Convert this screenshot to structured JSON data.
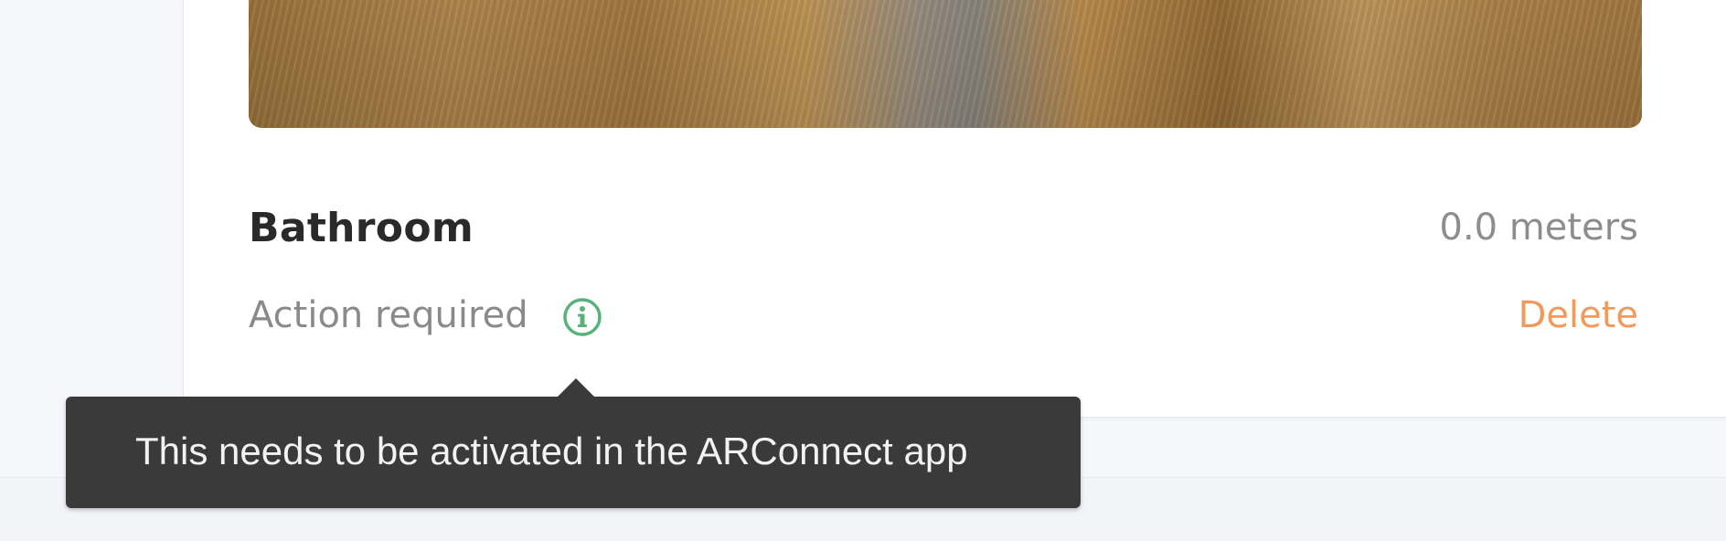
{
  "room": {
    "name": "Bathroom",
    "distance": "0.0 meters",
    "status": "Action required",
    "delete_label": "Delete"
  },
  "tooltip": {
    "text": "This needs to be activated in the ARConnect app"
  },
  "icons": {
    "status_icon": "info-circle-icon"
  },
  "colors": {
    "accent_green": "#58b27a",
    "delete_orange": "#f19a5c",
    "tooltip_bg": "#3a3a3a"
  }
}
